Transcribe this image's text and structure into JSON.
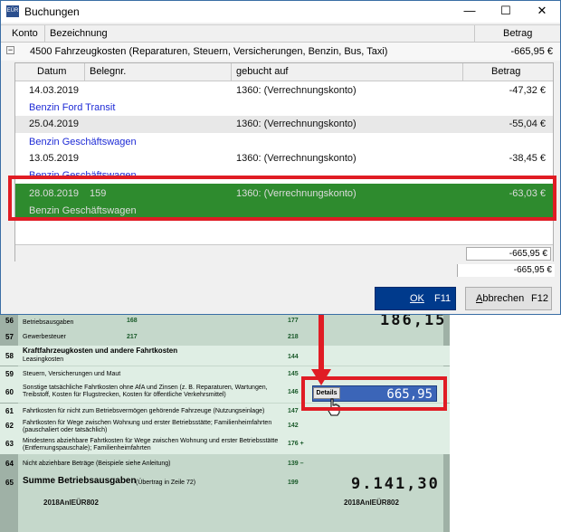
{
  "window": {
    "title": "Buchungen",
    "app_icon": "app-icon",
    "minimize": "—",
    "maximize": "☐",
    "close": "✕"
  },
  "accounts_header": {
    "konto": "Konto",
    "bezeichnung": "Bezeichnung",
    "betrag": "Betrag"
  },
  "group": {
    "toggle": "−",
    "label": "4500 Fahrzeugkosten (Reparaturen, Steuern, Versicherungen, Benzin, Bus, Taxi)",
    "amount": "-665,95 €"
  },
  "bookings_header": {
    "datum": "Datum",
    "belegnr": "Belegnr.",
    "gebucht_auf": "gebucht auf",
    "betrag": "Betrag"
  },
  "bookings": [
    {
      "datum": "14.03.2019",
      "belegnr": "",
      "gebucht_auf": "1360: (Verrechnungskonto)",
      "betrag": "-47,32 €",
      "text": "Benzin Ford Transit"
    },
    {
      "datum": "25.04.2019",
      "belegnr": "",
      "gebucht_auf": "1360: (Verrechnungskonto)",
      "betrag": "-55,04 €",
      "text": "Benzin Geschäftswagen"
    },
    {
      "datum": "13.05.2019",
      "belegnr": "",
      "gebucht_auf": "1360: (Verrechnungskonto)",
      "betrag": "-38,45 €",
      "text": "Benzin Geschäftswagen"
    }
  ],
  "selected_booking": {
    "datum": "28.08.2019",
    "belegnr": "159",
    "gebucht_auf": "1360: (Verrechnungskonto)",
    "betrag": "-63,03 €",
    "text": "Benzin Geschäftswagen"
  },
  "inner_total": "-665,95 €",
  "outer_total": "-665,95 €",
  "buttons": {
    "ok": "OK",
    "ok_key": "F11",
    "cancel": "Abbrechen",
    "cancel_key": "F12"
  },
  "form": {
    "rows": [
      {
        "num": "56",
        "text": "Betriebsausgaben",
        "code": "177",
        "left_code": "168"
      },
      {
        "num": "57",
        "text": "Gewerbesteuer",
        "code": "218",
        "left_code": "217"
      },
      {
        "num": "58",
        "text": "Kraftfahrzeugkosten und andere Fahrtkosten",
        "sub": "Leasingkosten",
        "code": "144"
      },
      {
        "num": "59",
        "text": "Steuern, Versicherungen und Maut",
        "code": "145"
      },
      {
        "num": "60",
        "text": "Sonstige tatsächliche Fahrtkosten ohne AfA und Zinsen (z. B. Reparaturen, Wartungen, Treibstoff, Kosten für Flugstrecken, Kosten für öffentliche Verkehrsmittel)",
        "code": "146"
      },
      {
        "num": "61",
        "text": "Fahrtkosten für nicht zum Betriebsvermögen gehörende Fahrzeuge (Nutzungseinlage)",
        "code": "147"
      },
      {
        "num": "62",
        "text": "Fahrtkosten für Wege zwischen Wohnung und erster Betriebsstätte; Familienheimfahrten (pauschaliert oder tatsächlich)",
        "code": "142"
      },
      {
        "num": "63",
        "text": "Mindestens abziehbare Fahrtkosten für Wege zwischen Wohnung und erster Betriebsstätte (Entfernungspauschale); Familienheimfahrten",
        "code": "176 +"
      },
      {
        "num": "64",
        "text": "Nicht abziehbare Beträge (Beispiele siehe Anleitung)",
        "code": "139 –"
      },
      {
        "num": "65",
        "text": "Summe Betriebsausgaben",
        "sub": "(Übertrag in Zeile 72)",
        "code": "199"
      }
    ],
    "top_value": "186,15",
    "input_value": "665,95",
    "details_label": "Details",
    "sum_value": "9.141,30",
    "footer_left": "2018AnlEÜR802",
    "footer_right": "2018AnlEÜR802"
  },
  "colors": {
    "selection_green": "#2e8b2e",
    "ok_blue": "#003a8c",
    "highlight_red": "#e01c24",
    "link_blue": "#1e2bd6"
  }
}
